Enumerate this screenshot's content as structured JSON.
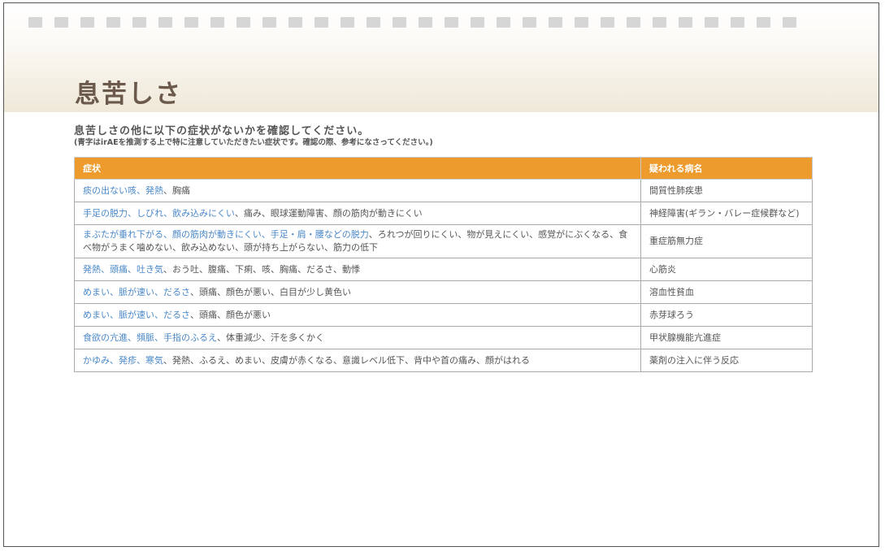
{
  "title": "息苦しさ",
  "intro": "息苦しさの他に以下の症状がないかを確認してください。",
  "note": "(青字はirAEを推測する上で特に注意していただきたい症状です。確認の際、参考になさってください。)",
  "table": {
    "headers": [
      "症状",
      "疑われる病名"
    ],
    "rows": [
      {
        "symptoms": [
          {
            "t": "痰の出ない咳、発熱",
            "b": true
          },
          {
            "t": "、胸痛",
            "b": false
          }
        ],
        "disease": "間質性肺疾患"
      },
      {
        "symptoms": [
          {
            "t": "手足の脱力、しびれ、飲み込みにくい",
            "b": true
          },
          {
            "t": "、痛み、眼球運動障害、顔の筋肉が動きにくい",
            "b": false
          }
        ],
        "disease": "神経障害(ギラン・バレー症候群など)"
      },
      {
        "symptoms": [
          {
            "t": "まぶたが垂れ下がる、顔の筋肉が動きにくい、手足・肩・腰などの脱力",
            "b": true
          },
          {
            "t": "、ろれつが回りにくい、物が見えにくい、感覚がにぶくなる、食べ物がうまく噛めない、飲み込めない、頭が持ち上がらない、筋力の低下",
            "b": false
          }
        ],
        "disease": "重症筋無力症"
      },
      {
        "symptoms": [
          {
            "t": "発熱、頭痛、吐き気",
            "b": true
          },
          {
            "t": "、おう吐、腹痛、下痢、咳、胸痛、だるさ、動悸",
            "b": false
          }
        ],
        "disease": "心筋炎"
      },
      {
        "symptoms": [
          {
            "t": "めまい、脈が速い、だるさ",
            "b": true
          },
          {
            "t": "、頭痛、顔色が悪い、白目が少し黄色い",
            "b": false
          }
        ],
        "disease": "溶血性貧血"
      },
      {
        "symptoms": [
          {
            "t": "めまい、脈が速い、だるさ",
            "b": true
          },
          {
            "t": "、頭痛、顔色が悪い",
            "b": false
          }
        ],
        "disease": "赤芽球ろう"
      },
      {
        "symptoms": [
          {
            "t": "食欲の亢進、頻脈、手指のふるえ",
            "b": true
          },
          {
            "t": "、体重減少、汗を多くかく",
            "b": false
          }
        ],
        "disease": "甲状腺機能亢進症"
      },
      {
        "symptoms": [
          {
            "t": "かゆみ、発疹、寒気",
            "b": true
          },
          {
            "t": "、発熱、ふるえ、めまい、皮膚が赤くなる、意識レベル低下、背中や首の痛み、顔がはれる",
            "b": false
          }
        ],
        "disease": "薬剤の注入に伴う反応"
      }
    ]
  },
  "colors": {
    "header_bg": "#ed9b2c",
    "highlight_text": "#4a88c9",
    "title": "#6b5a4c"
  }
}
